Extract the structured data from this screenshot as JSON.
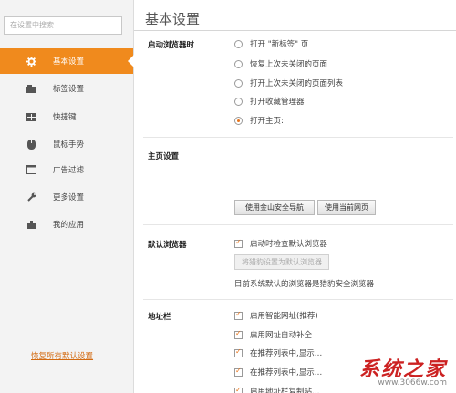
{
  "sidebar": {
    "search_placeholder": "在设置中搜索",
    "items": [
      {
        "label": "基本设置",
        "icon": "gear-icon"
      },
      {
        "label": "标签设置",
        "icon": "tab-icon"
      },
      {
        "label": "快捷键",
        "icon": "keyboard-icon"
      },
      {
        "label": "鼠标手势",
        "icon": "mouse-icon"
      },
      {
        "label": "广告过滤",
        "icon": "ad-filter-icon"
      },
      {
        "label": "更多设置",
        "icon": "wrench-icon"
      },
      {
        "label": "我的应用",
        "icon": "app-icon"
      }
    ],
    "restore_label": "恢复所有默认设置"
  },
  "main": {
    "title": "基本设置",
    "startup": {
      "label": "启动浏览器时",
      "options": [
        "打开 \"新标签\" 页",
        "恢复上次未关闭的页面",
        "打开上次未关闭的页面列表",
        "打开收藏管理器",
        "打开主页:"
      ],
      "selected_index": 4
    },
    "homepage": {
      "label": "主页设置",
      "btn_nav": "使用金山安全导航",
      "btn_current": "使用当前网页"
    },
    "default_browser": {
      "label": "默认浏览器",
      "check_label": "启动时检查默认浏览器",
      "set_default_btn": "将猎豹设置为默认浏览器",
      "status": "目前系统默认的浏览器是猎豹安全浏览器"
    },
    "address_bar": {
      "label": "地址栏",
      "options": [
        "启用智能网址(推荐)",
        "启用网址自动补全",
        "在推荐列表中,显示…",
        "在推荐列表中,显示…",
        "启用地址栏复制粘…"
      ]
    }
  },
  "watermark": {
    "big": "系统之家",
    "small": "www.3066w.com"
  }
}
